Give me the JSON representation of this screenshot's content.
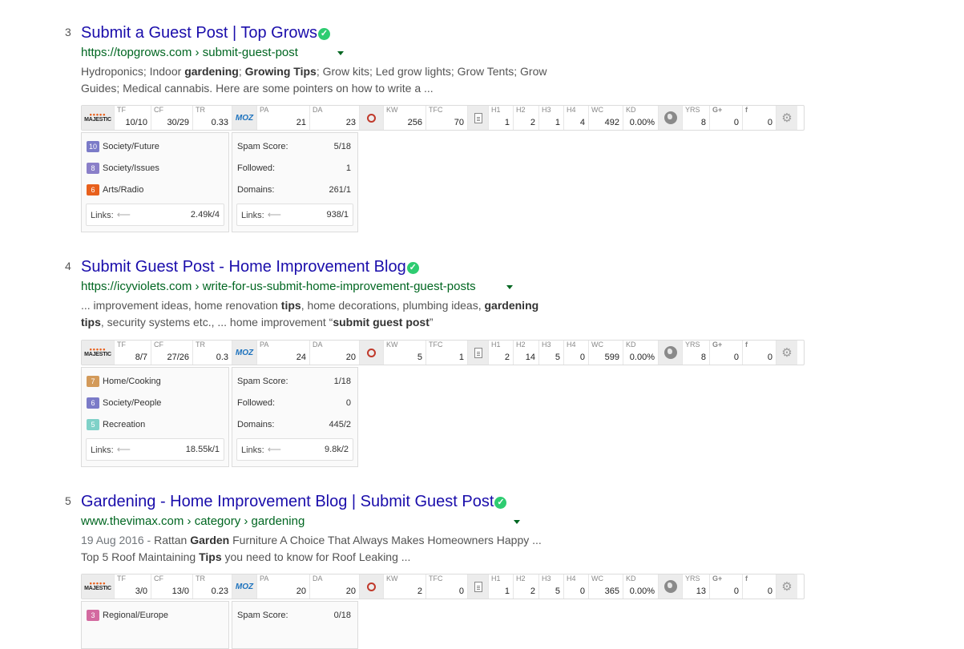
{
  "results": [
    {
      "rank": "3",
      "title": "Submit a Guest Post | Top Grows",
      "url": "https://topgrows.com › submit-guest-post",
      "snippet_html": "Hydroponics; Indoor <b>gardening</b>; <b>Growing Tips</b>; Grow kits; Led grow lights; Grow Tents; Grow Guides; Medical cannabis. Here are some pointers on how to write a ...",
      "metrics": {
        "TF": "10/10",
        "CF": "30/29",
        "TR": "0.33",
        "PA": "21",
        "DA": "23",
        "KW": "256",
        "TFC": "70",
        "H1": "1",
        "H2": "2",
        "H3": "1",
        "H4": "4",
        "WC": "492",
        "KD": "0.00%",
        "YRS": "8",
        "GPLUS": "0",
        "FB": "0"
      },
      "topics": [
        {
          "count": "10",
          "label": "Society/Future",
          "color": "#7b7bc8"
        },
        {
          "count": "8",
          "label": "Society/Issues",
          "color": "#8a7fc9"
        },
        {
          "count": "6",
          "label": "Arts/Radio",
          "color": "#e8601c"
        }
      ],
      "majestic_links": "2.49k/4",
      "moz": {
        "spam_score": "5/18",
        "followed": "1",
        "domains": "261/1",
        "links": "938/1"
      }
    },
    {
      "rank": "4",
      "title": "Submit Guest Post - Home Improvement Blog",
      "url": "https://icyviolets.com › write-for-us-submit-home-improvement-guest-posts",
      "snippet_html": "... improvement ideas, home renovation <b>tips</b>, home decorations, plumbing ideas, <b>gardening tips</b>, security systems etc., ... home improvement “<b>submit guest post</b>”",
      "metrics": {
        "TF": "8/7",
        "CF": "27/26",
        "TR": "0.3",
        "PA": "24",
        "DA": "20",
        "KW": "5",
        "TFC": "1",
        "H1": "2",
        "H2": "14",
        "H3": "5",
        "H4": "0",
        "WC": "599",
        "KD": "0.00%",
        "YRS": "8",
        "GPLUS": "0",
        "FB": "0"
      },
      "topics": [
        {
          "count": "7",
          "label": "Home/Cooking",
          "color": "#d39a5a"
        },
        {
          "count": "6",
          "label": "Society/People",
          "color": "#7b7bc8"
        },
        {
          "count": "5",
          "label": "Recreation",
          "color": "#7fd1c8"
        }
      ],
      "majestic_links": "18.55k/1",
      "moz": {
        "spam_score": "1/18",
        "followed": "0",
        "domains": "445/2",
        "links": "9.8k/2"
      }
    },
    {
      "rank": "5",
      "title": "Gardening - Home Improvement Blog | Submit Guest Post",
      "url": "www.thevimax.com › category › gardening",
      "snippet_html": "<span class=\"date\">19 Aug 2016 - </span>Rattan <b>Garden</b> Furniture A Choice That Always Makes Homeowners Happy ... Top 5 Roof Maintaining <b>Tips</b> you need to know for Roof Leaking ...",
      "metrics": {
        "TF": "3/0",
        "CF": "13/0",
        "TR": "0.23",
        "PA": "20",
        "DA": "20",
        "KW": "2",
        "TFC": "0",
        "H1": "1",
        "H2": "2",
        "H3": "5",
        "H4": "0",
        "WC": "365",
        "KD": "0.00%",
        "YRS": "13",
        "GPLUS": "0",
        "FB": "0"
      },
      "topics": [
        {
          "count": "3",
          "label": "Regional/Europe",
          "color": "#d36aa0"
        }
      ],
      "moz": {
        "spam_score": "0/18"
      }
    }
  ],
  "labels": {
    "TF": "TF",
    "CF": "CF",
    "TR": "TR",
    "PA": "PA",
    "DA": "DA",
    "KW": "KW",
    "TFC": "TFC",
    "H1": "H1",
    "H2": "H2",
    "H3": "H3",
    "H4": "H4",
    "WC": "WC",
    "KD": "KD",
    "YRS": "YRS",
    "majestic": "MAJESTIC",
    "moz": "MOZ",
    "gplus": "G+",
    "fb": "f",
    "spam_score": "Spam Score:",
    "followed": "Followed:",
    "domains": "Domains:",
    "links": "Links:"
  }
}
